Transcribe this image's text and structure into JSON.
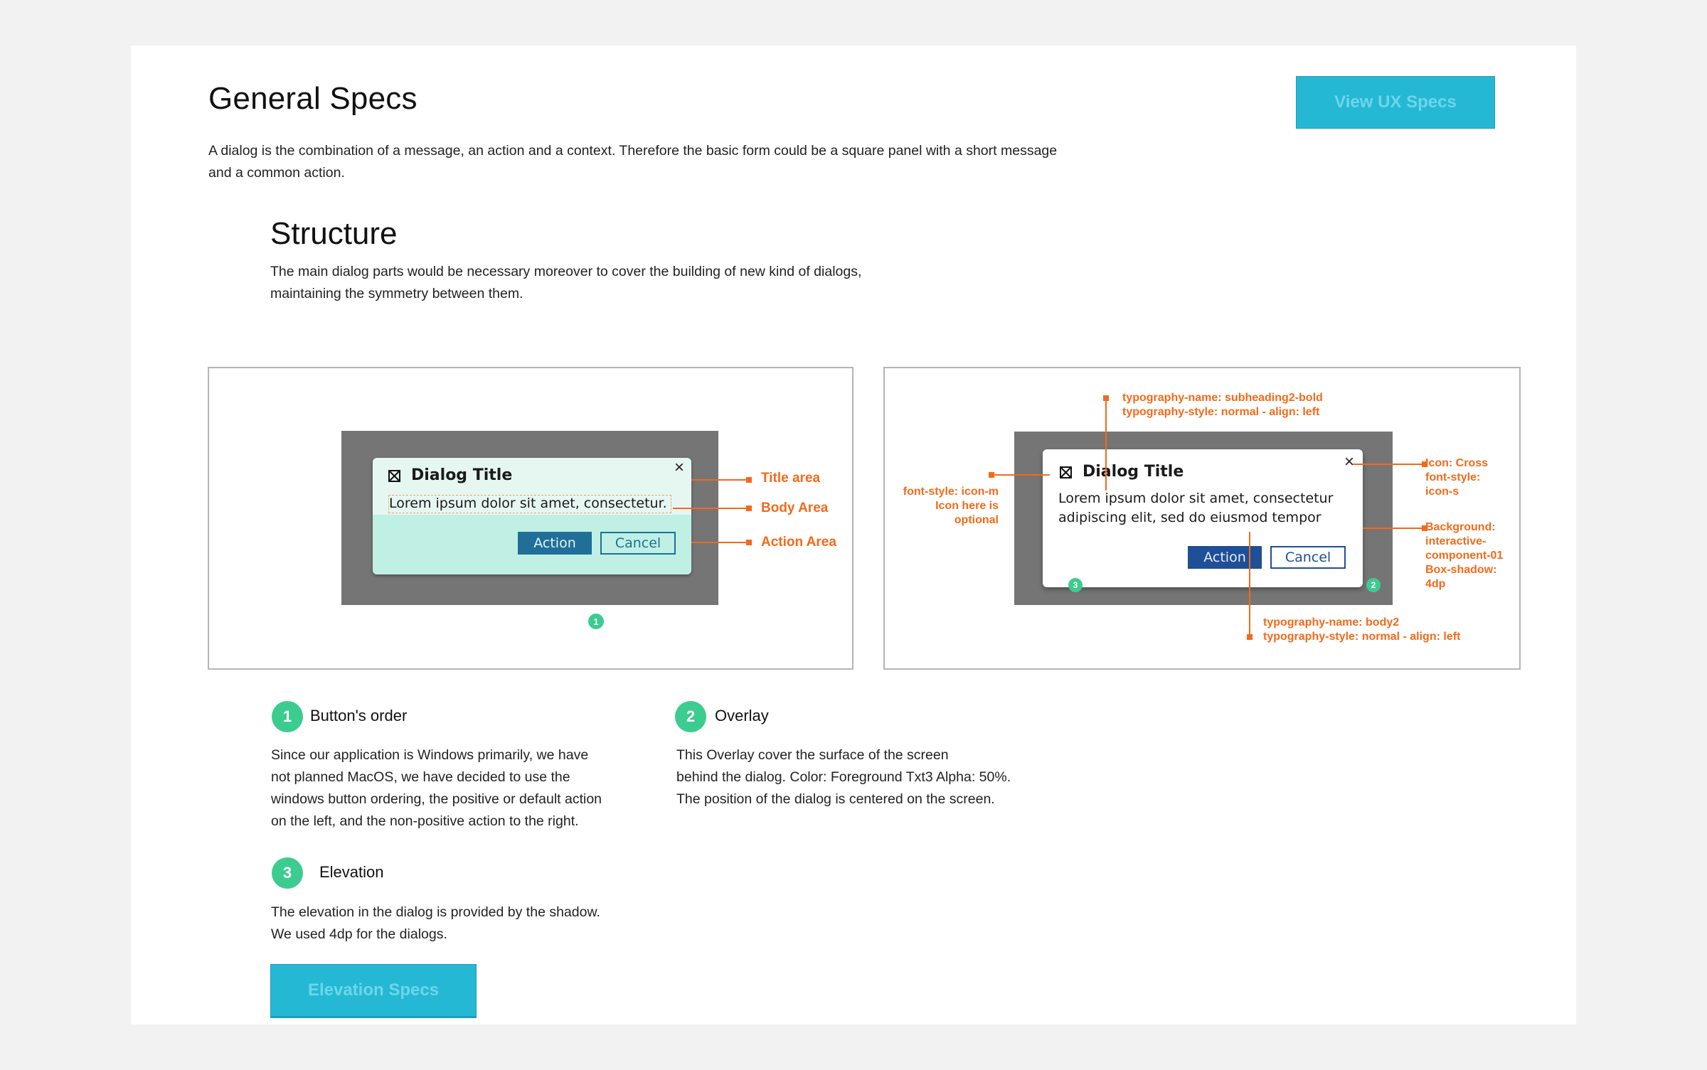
{
  "header": {
    "title": "General Specs",
    "intro": "A dialog is the combination of a message, an action and a context. Therefore the basic form could be a square panel with a short message and a common action.",
    "ux_button": "View UX Specs"
  },
  "structure": {
    "title": "Structure",
    "text": "The main dialog parts would be necessary moreover to cover the building of new kind of dialogs, maintaining the symmetry between them."
  },
  "diagram_left": {
    "dialog_title": "Dialog Title",
    "body_text": "Lorem ipsum dolor sit amet, consectetur.",
    "action_label": "Action",
    "cancel_label": "Cancel",
    "close_glyph": "×",
    "badge": "1",
    "annotations": {
      "title_area": "Title area",
      "body_area": "Body Area",
      "action_area": "Action Area"
    },
    "colors": {
      "title_area": "#e6f7f2",
      "action_area": "#bff0e3",
      "action_button": "#1f6f99",
      "cancel_border": "#1f6f99"
    }
  },
  "diagram_right": {
    "dialog_title": "Dialog Title",
    "body_line1": "Lorem ipsum dolor sit amet, consectetur",
    "body_line2": "adipiscing elit, sed do eiusmod tempor",
    "action_label": "Action",
    "cancel_label": "Cancel",
    "close_glyph": "×",
    "badge_elevation": "3",
    "badge_overlay": "2",
    "annotations": {
      "title_typo_1": "typography-name: subheading2-bold",
      "title_typo_2": "typography-style: normal - align: left",
      "icon_1": "font-style: icon-m",
      "icon_2": "Icon here is",
      "icon_3": "optional",
      "cross_1": "Icon: Cross",
      "cross_2": "font-style:",
      "cross_3": "icon-s",
      "bg_1": "Background:",
      "bg_2": "interactive-",
      "bg_3": "component-01",
      "bg_4": "Box-shadow:",
      "bg_5": "4dp",
      "body_typo_1": "typography-name: body2",
      "body_typo_2": "typography-style: normal - align: left"
    },
    "colors": {
      "action_button": "#1f4f96",
      "cancel_border": "#1f4f96"
    }
  },
  "notes": {
    "buttons_order": {
      "badge": "1",
      "title": "Button's order",
      "lines": [
        "Since our application is Windows primarily, we have",
        "not planned MacOS, we have decided to use the",
        "windows button ordering, the positive or default action",
        "on the left, and the non-positive action to the right."
      ]
    },
    "overlay": {
      "badge": "2",
      "title": "Overlay",
      "lines": [
        "This Overlay cover the surface of the screen",
        "behind the dialog. Color: Foreground Txt3 Alpha: 50%.",
        "The position of the dialog is centered on the screen."
      ]
    },
    "elevation": {
      "badge": "3",
      "title": "Elevation",
      "lines": [
        "The elevation in the dialog is provided by the shadow.",
        "We used 4dp for the dialogs."
      ]
    }
  },
  "elevation_button": "Elevation Specs",
  "colors": {
    "accent_button": "#25b8d4",
    "annotation": "#f36a1a",
    "badge": "#3dcc8f",
    "overlay": "#757575"
  }
}
